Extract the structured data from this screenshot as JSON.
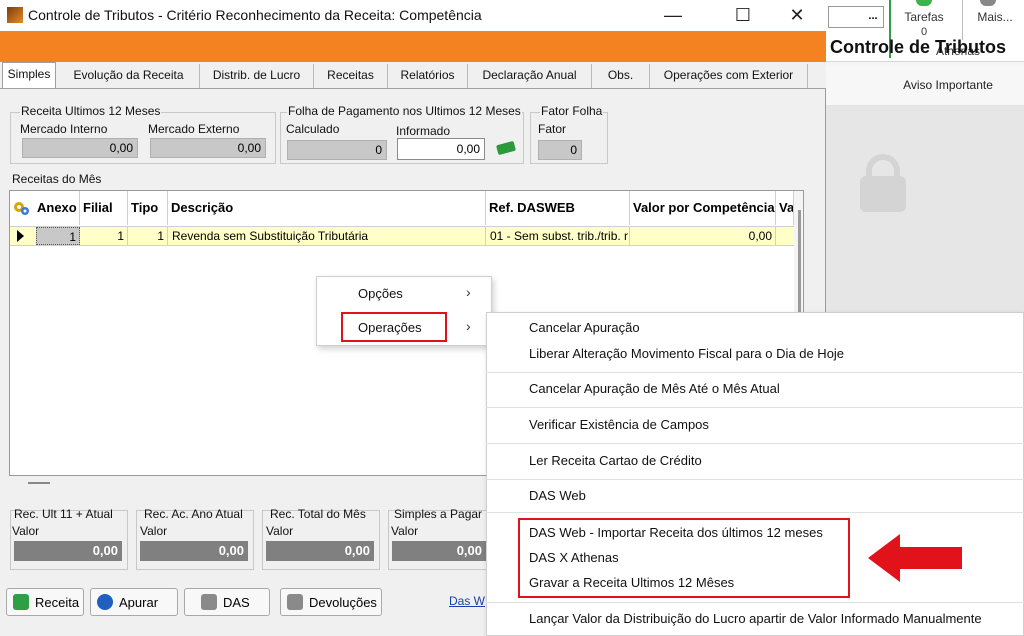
{
  "window": {
    "title": "Controle de Tributos - Critério Reconhecimento da Receita:  Competência",
    "header": "Controle de Tributos",
    "minimize": "—",
    "maximize": "☐",
    "close": "✕"
  },
  "tabs": [
    {
      "label": "Simples"
    },
    {
      "label": "Evolução da Receita"
    },
    {
      "label": "Distrib. de Lucro"
    },
    {
      "label": "Receitas"
    },
    {
      "label": "Relatórios"
    },
    {
      "label": "Declaração Anual"
    },
    {
      "label": "Obs."
    },
    {
      "label": "Operações com Exterior"
    }
  ],
  "receita12": {
    "title": "Receita Ultimos 12 Meses",
    "interno_label": "Mercado Interno",
    "interno_value": "0,00",
    "externo_label": "Mercado Externo",
    "externo_value": "0,00"
  },
  "folha": {
    "title": "Folha de Pagamento nos Ultimos 12 Meses",
    "calculado_label": "Calculado",
    "calculado_value": "0",
    "informado_label": "Informado",
    "informado_value": "0,00"
  },
  "fator": {
    "title": "Fator Folha",
    "label": "Fator",
    "value": "0"
  },
  "grid": {
    "title": "Receitas do Mês",
    "headers": [
      "Anexo",
      "Filial",
      "Tipo",
      "Descrição",
      "Ref. DASWEB",
      "Valor por Competência",
      "Va"
    ],
    "row": {
      "anexo": "1",
      "filial": "1",
      "tipo": "1",
      "descricao": "Revenda sem Substituição Tributária",
      "ref": "01 - Sem subst. trib./trib. r",
      "valor": "0,00"
    }
  },
  "totals": [
    {
      "title": "Rec. Ult  11 + Atual",
      "label": "Valor",
      "value": "0,00"
    },
    {
      "title": "Rec. Ac. Ano Atual",
      "label": "Valor",
      "value": "0,00"
    },
    {
      "title": "Rec. Total do Mês",
      "label": "Valor",
      "value": "0,00"
    },
    {
      "title": "Simples a Pagar",
      "label": "Valor",
      "value": "0,00"
    }
  ],
  "buttons": {
    "receita": "Receita",
    "apurar": "Apurar",
    "das": "DAS",
    "devolucoes": "Devoluções",
    "das_link": "Das W"
  },
  "context_menu": {
    "items": [
      {
        "label": "Opções",
        "chevron": "›"
      },
      {
        "label": "Operações",
        "chevron": "›"
      }
    ]
  },
  "submenu": {
    "items": [
      "Cancelar Apuração",
      "Liberar Alteração Movimento Fiscal para o Dia de Hoje",
      "Cancelar Apuração de Mês Até o Mês Atual",
      "Verificar Existência de Campos",
      "Ler Receita Cartao de Crédito",
      "DAS Web",
      "DAS Web - Importar Receita dos últimos 12 meses",
      "DAS X Athenas",
      "Gravar a Receita Ultimos 12 Mêses",
      "Lançar Valor da Distribuição do Lucro apartir de Valor Informado Manualmente"
    ]
  },
  "background": {
    "dots": "...",
    "tarefas": "Tarefas",
    "tarefas_count": "0",
    "mais": "Mais...",
    "athenas": "Athenas",
    "aviso": "Aviso Importante"
  },
  "colors": {
    "header_orange": "#f58220",
    "highlight_red": "#e2121a",
    "row_yellow": "#ffffc8"
  }
}
